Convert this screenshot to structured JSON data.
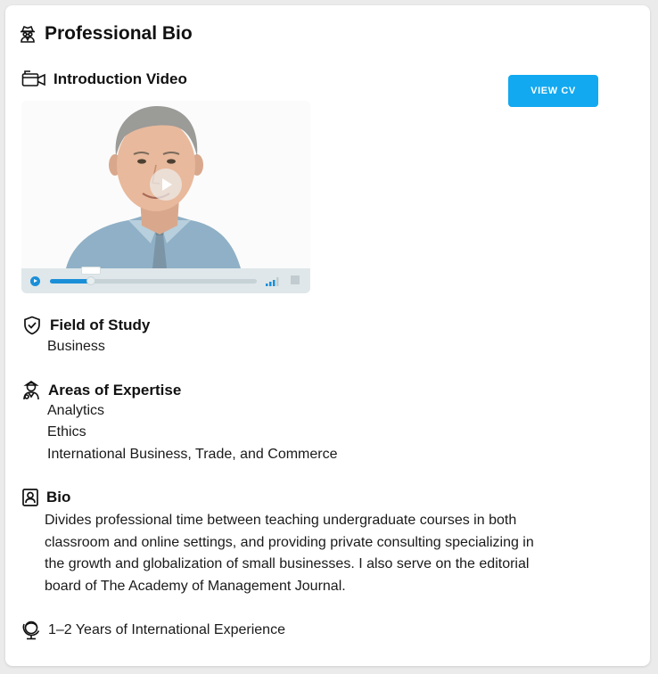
{
  "card": {
    "title": "Professional Bio",
    "title_icon": "spy-agent-icon"
  },
  "video_section": {
    "label": "Introduction Video",
    "icon": "video-camera-icon",
    "progress": 0.2,
    "view_cv_label": "VIEW CV"
  },
  "field_of_study": {
    "label": "Field of Study",
    "icon": "shield-check-icon",
    "value": "Business"
  },
  "areas_of_expertise": {
    "label": "Areas of Expertise",
    "icon": "expert-person-icon",
    "items": [
      "Analytics",
      "Ethics",
      "International Business, Trade, and Commerce"
    ]
  },
  "bio": {
    "label": "Bio",
    "icon": "id-badge-icon",
    "lines": [
      "Divides professional time between teaching undergraduate courses in both",
      "classroom and online settings, and providing private consulting specializing in",
      "the growth and globalization of small businesses. I also serve on the editorial",
      "board of The Academy of Management Journal."
    ]
  },
  "experience": {
    "icon": "globe-stand-icon",
    "text": "1–2 Years of International Experience"
  },
  "colors": {
    "accent": "#12a9f0",
    "player_accent": "#1a8fd8"
  }
}
